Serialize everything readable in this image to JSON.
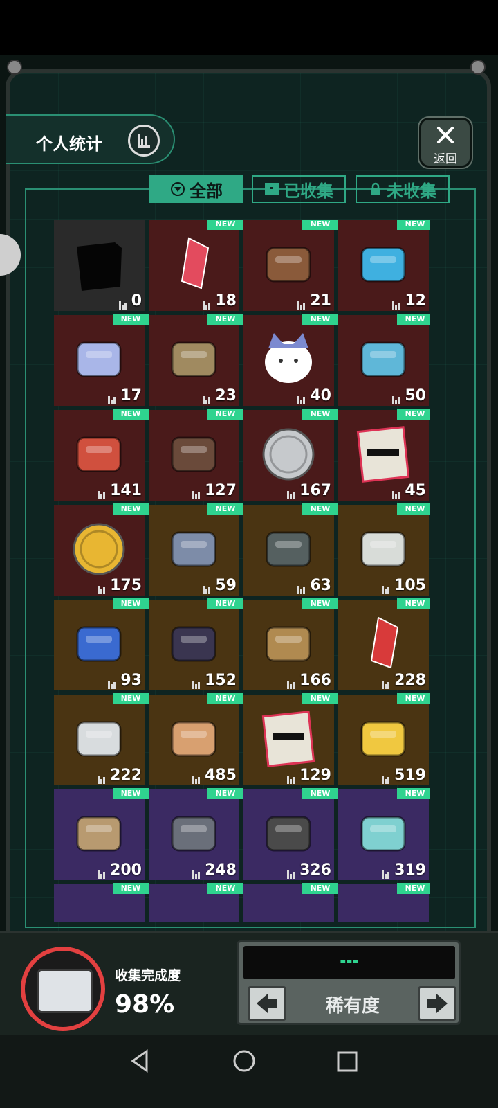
{
  "header": {
    "stats_label": "个人统计",
    "back_label": "返回"
  },
  "tabs": [
    {
      "label": "全部",
      "active": true
    },
    {
      "label": "已收集",
      "active": false
    },
    {
      "label": "未收集",
      "active": false
    }
  ],
  "new_badge": "NEW",
  "items": [
    {
      "count": "0",
      "new": false,
      "bg": "#2a2a2a",
      "icon": "unknown-silhouette-icon"
    },
    {
      "count": "18",
      "new": true,
      "bg": "#4a1a1a",
      "icon": "crystal-icon"
    },
    {
      "count": "21",
      "new": true,
      "bg": "#4a1a1a",
      "icon": "retro-tv-icon"
    },
    {
      "count": "12",
      "new": true,
      "bg": "#4a1a1a",
      "icon": "sports-car-icon"
    },
    {
      "count": "17",
      "new": true,
      "bg": "#4a1a1a",
      "icon": "trophy-cup-icon"
    },
    {
      "count": "23",
      "new": true,
      "bg": "#4a1a1a",
      "icon": "statue-icon"
    },
    {
      "count": "40",
      "new": true,
      "bg": "#4a1a1a",
      "icon": "cat-plush-icon"
    },
    {
      "count": "50",
      "new": true,
      "bg": "#4a1a1a",
      "icon": "drone-icon"
    },
    {
      "count": "141",
      "new": true,
      "bg": "#4a1a1a",
      "icon": "card-icon"
    },
    {
      "count": "127",
      "new": true,
      "bg": "#4a1a1a",
      "icon": "bars-icon"
    },
    {
      "count": "167",
      "new": true,
      "bg": "#4a1a1a",
      "icon": "silver-coin-icon"
    },
    {
      "count": "45",
      "new": true,
      "bg": "#4a1a1a",
      "icon": "certificate-icon"
    },
    {
      "count": "175",
      "new": true,
      "bg": "#4a1a1a",
      "icon": "bitcoin-icon"
    },
    {
      "count": "59",
      "new": true,
      "bg": "#4a3412",
      "icon": "overalls-icon"
    },
    {
      "count": "63",
      "new": true,
      "bg": "#4a3412",
      "icon": "quadcopter-icon"
    },
    {
      "count": "105",
      "new": true,
      "bg": "#4a3412",
      "icon": "robot-dog-icon"
    },
    {
      "count": "93",
      "new": true,
      "bg": "#4a3412",
      "icon": "star-map-icon"
    },
    {
      "count": "152",
      "new": true,
      "bg": "#4a3412",
      "icon": "guitar-icon"
    },
    {
      "count": "166",
      "new": true,
      "bg": "#4a3412",
      "icon": "phone-icon"
    },
    {
      "count": "228",
      "new": true,
      "bg": "#4a3412",
      "icon": "gem-wand-icon"
    },
    {
      "count": "222",
      "new": true,
      "bg": "#4a3412",
      "icon": "gpu-card-icon"
    },
    {
      "count": "485",
      "new": true,
      "bg": "#4a3412",
      "icon": "knit-hat-icon"
    },
    {
      "count": "129",
      "new": true,
      "bg": "#4a3412",
      "icon": "certificate-icon"
    },
    {
      "count": "519",
      "new": true,
      "bg": "#4a3412",
      "icon": "gold-nugget-icon"
    },
    {
      "count": "200",
      "new": true,
      "bg": "#3b2a63",
      "icon": "terracotta-warrior-icon"
    },
    {
      "count": "248",
      "new": true,
      "bg": "#3b2a63",
      "icon": "hovercraft-icon"
    },
    {
      "count": "326",
      "new": true,
      "bg": "#3b2a63",
      "icon": "gadget-crew-icon"
    },
    {
      "count": "319",
      "new": true,
      "bg": "#3b2a63",
      "icon": "game-robot-icon"
    },
    {
      "count": "",
      "new": true,
      "bg": "#3b2a63",
      "icon": "partial-item-icon"
    },
    {
      "count": "",
      "new": true,
      "bg": "#3b2a63",
      "icon": "partial-item-icon"
    },
    {
      "count": "",
      "new": true,
      "bg": "#3b2a63",
      "icon": "partial-item-icon"
    },
    {
      "count": "",
      "new": true,
      "bg": "#3b2a63",
      "icon": "partial-item-icon"
    }
  ],
  "footer": {
    "completion_label": "收集完成度",
    "completion_value": "98%",
    "completion_fraction": 0.98,
    "sort_display": "---",
    "sort_label": "稀有度"
  }
}
